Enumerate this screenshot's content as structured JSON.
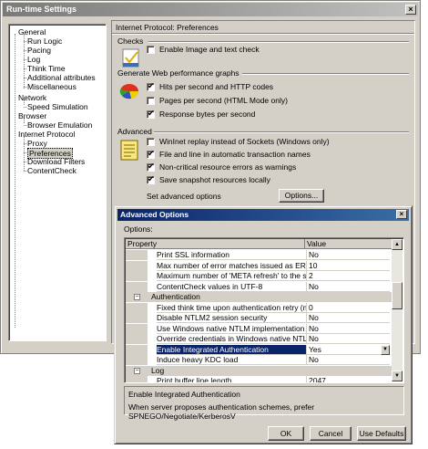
{
  "window": {
    "title": "Run-time Settings",
    "close_glyph": "×"
  },
  "tree": {
    "items": [
      {
        "label": "General",
        "level": 0
      },
      {
        "label": "Run Logic",
        "level": 1
      },
      {
        "label": "Pacing",
        "level": 1
      },
      {
        "label": "Log",
        "level": 1
      },
      {
        "label": "Think Time",
        "level": 1
      },
      {
        "label": "Additional attributes",
        "level": 1
      },
      {
        "label": "Miscellaneous",
        "level": 1
      },
      {
        "label": "Network",
        "level": 0
      },
      {
        "label": "Speed Simulation",
        "level": 1
      },
      {
        "label": "Browser",
        "level": 0
      },
      {
        "label": "Browser Emulation",
        "level": 1
      },
      {
        "label": "Internet Protocol",
        "level": 0
      },
      {
        "label": "Proxy",
        "level": 1
      },
      {
        "label": "Preferences",
        "level": 1,
        "selected": true
      },
      {
        "label": "Download Filters",
        "level": 1
      },
      {
        "label": "ContentCheck",
        "level": 1
      }
    ]
  },
  "panel": {
    "title": "Internet Protocol: Preferences",
    "checks": {
      "heading": "Checks",
      "enable_image_text": {
        "label": "Enable Image and text check",
        "checked": false
      }
    },
    "graphs": {
      "heading": "Generate Web performance graphs",
      "hits": {
        "label": "Hits per second and HTTP codes",
        "checked": true
      },
      "pages": {
        "label": "Pages per second (HTML Mode only)",
        "checked": false
      },
      "bytes": {
        "label": "Response bytes per second",
        "checked": true
      }
    },
    "advanced": {
      "heading": "Advanced",
      "wininet": {
        "label": "WinInet replay instead of Sockets (Windows only)",
        "checked": false
      },
      "file_line": {
        "label": "File and line in automatic transaction names",
        "checked": true
      },
      "noncritical": {
        "label": "Non-critical resource errors as warnings",
        "checked": true
      },
      "snapshot": {
        "label": "Save snapshot resources locally",
        "checked": true
      },
      "set_options_label": "Set advanced options",
      "options_button": "Options..."
    }
  },
  "dialog": {
    "title": "Advanced Options",
    "close_glyph": "×",
    "options_label": "Options:",
    "columns": {
      "property": "Property",
      "value": "Value"
    },
    "rows": [
      {
        "name": "Print SSL information",
        "value": "No"
      },
      {
        "name": "Max number of error matches issued as ERRORS",
        "value": "10"
      },
      {
        "name": "Maximum number of 'META refresh' to the sam...",
        "value": "2"
      },
      {
        "name": "ContentCheck values in UTF-8",
        "value": "No"
      },
      {
        "name": "Authentication",
        "category": true,
        "expander": "−"
      },
      {
        "name": "Fixed think time upon authentication retry (msec)",
        "value": "0"
      },
      {
        "name": "Disable NTLM2 session security",
        "value": "No"
      },
      {
        "name": "Use Windows native NTLM implementation",
        "value": "No"
      },
      {
        "name": "Override credentials in Windows native NTLM i...",
        "value": "No"
      },
      {
        "name": "Enable Integrated Authentication",
        "value": "Yes",
        "selected": true
      },
      {
        "name": "Induce heavy KDC load",
        "value": "No"
      },
      {
        "name": "Log",
        "category": true,
        "expander": "−"
      },
      {
        "name": "Print buffer line length",
        "value": "2047"
      }
    ],
    "description": {
      "title": "Enable Integrated Authentication",
      "text": "When server proposes authentication schemes, prefer SPNEGO/Negotiate/KerberosV"
    },
    "buttons": {
      "ok": "OK",
      "cancel": "Cancel",
      "defaults": "Use Defaults"
    }
  }
}
